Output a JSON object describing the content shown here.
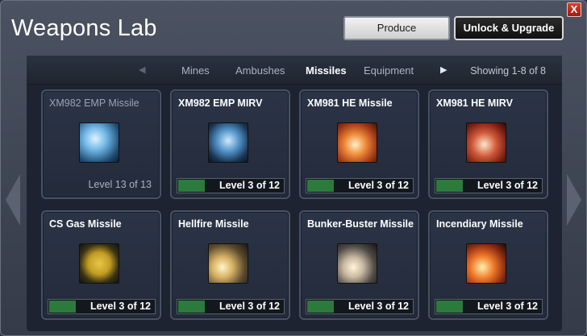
{
  "window": {
    "title": "Weapons Lab",
    "close_label": "X"
  },
  "header": {
    "produce_label": "Produce",
    "upgrade_label": "Unlock & Upgrade"
  },
  "tabs": {
    "prev_icon": "◀",
    "next_icon": "▶",
    "items": [
      {
        "label": "Mines",
        "active": false
      },
      {
        "label": "Ambushes",
        "active": false
      },
      {
        "label": "Missiles",
        "active": true
      },
      {
        "label": "Equipment",
        "active": false
      }
    ],
    "showing": "Showing 1-8 of 8"
  },
  "weapons": [
    {
      "name": "XM982 EMP Missile",
      "icon": "emp-missile-icon",
      "level": "Level 13 of 13",
      "progress": 1.0,
      "maxed": true
    },
    {
      "name": "XM982 EMP MIRV",
      "icon": "emp-mirv-icon",
      "level": "Level 3 of 12",
      "progress": 0.25
    },
    {
      "name": "XM981 HE Missile",
      "icon": "he-missile-icon",
      "level": "Level 3 of 12",
      "progress": 0.25
    },
    {
      "name": "XM981 HE MIRV",
      "icon": "he-mirv-icon",
      "level": "Level 3 of 12",
      "progress": 0.25
    },
    {
      "name": "CS Gas Missile",
      "icon": "gas-missile-icon",
      "level": "Level 3 of 12",
      "progress": 0.25
    },
    {
      "name": "Hellfire Missile",
      "icon": "hellfire-missile-icon",
      "level": "Level 3 of 12",
      "progress": 0.25
    },
    {
      "name": "Bunker-Buster Missile",
      "icon": "bunker-buster-icon",
      "level": "Level 3 of 12",
      "progress": 0.25
    },
    {
      "name": "Incendiary Missile",
      "icon": "incendiary-missile-icon",
      "level": "Level 3 of 12",
      "progress": 0.25
    }
  ],
  "colors": {
    "progress_fill": "#2c7a3c",
    "panel": "#1d2330"
  }
}
